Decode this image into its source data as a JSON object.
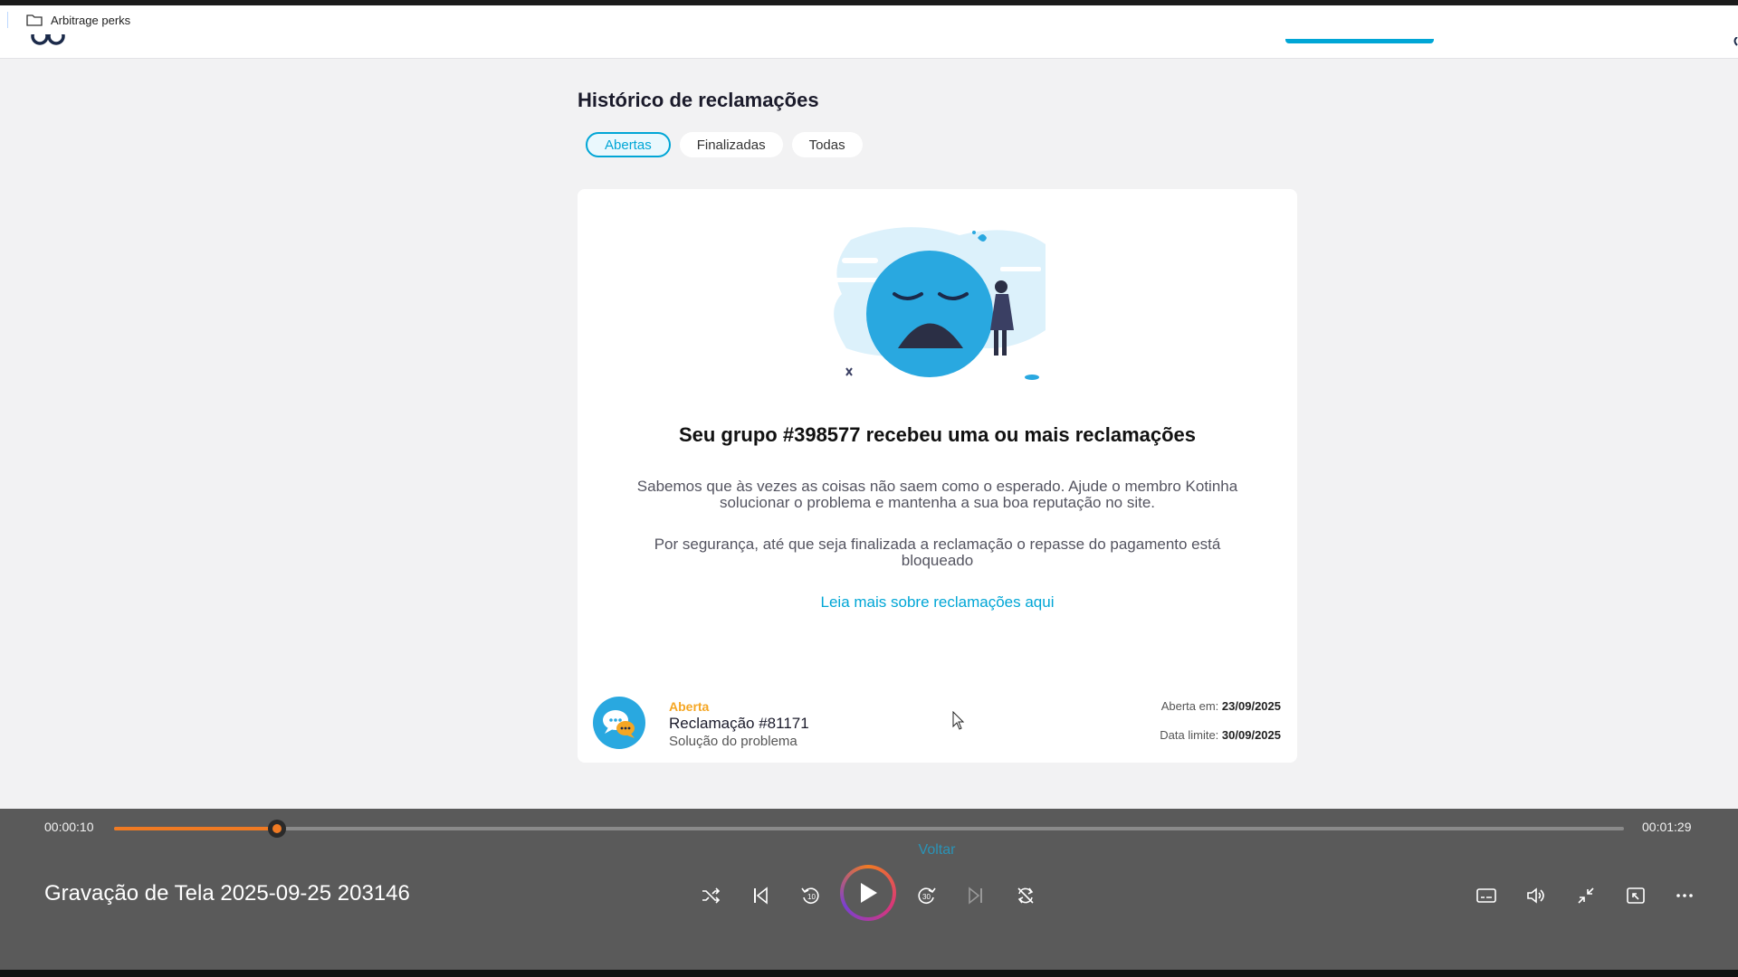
{
  "browser": {
    "tab_title": "Arbitrage perks"
  },
  "page": {
    "title": "Histórico de reclamações",
    "filters": [
      {
        "label": "Abertas",
        "active": true
      },
      {
        "label": "Finalizadas",
        "active": false
      },
      {
        "label": "Todas",
        "active": false
      }
    ],
    "card": {
      "heading": "Seu grupo #398577 recebeu uma ou mais reclamações",
      "paragraph1": "Sabemos que às vezes as coisas não saem como o esperado. Ajude o membro Kotinha solucionar o problema e mantenha a sua boa reputação no site.",
      "paragraph2": "Por segurança, até que seja finalizada a reclamação o repasse do pagamento está bloqueado",
      "link": "Leia mais sobre reclamações aqui"
    },
    "claim": {
      "status": "Aberta",
      "title": "Reclamação #81171",
      "subtitle": "Solução do problema",
      "opened_label": "Aberta em:",
      "opened_value": "23/09/2025",
      "deadline_label": "Data limite:",
      "deadline_value": "30/09/2025"
    }
  },
  "player": {
    "current_time": "00:00:10",
    "duration": "00:01:29",
    "progress_fraction": 0.108,
    "overlay_text": "Voltar",
    "media_title": "Gravação de Tela 2025-09-25 203146",
    "skip_back_label": "10",
    "skip_forward_label": "30"
  },
  "colors": {
    "accent": "#00a6d6",
    "status_open": "#f5a623",
    "seek": "#f07a23"
  }
}
